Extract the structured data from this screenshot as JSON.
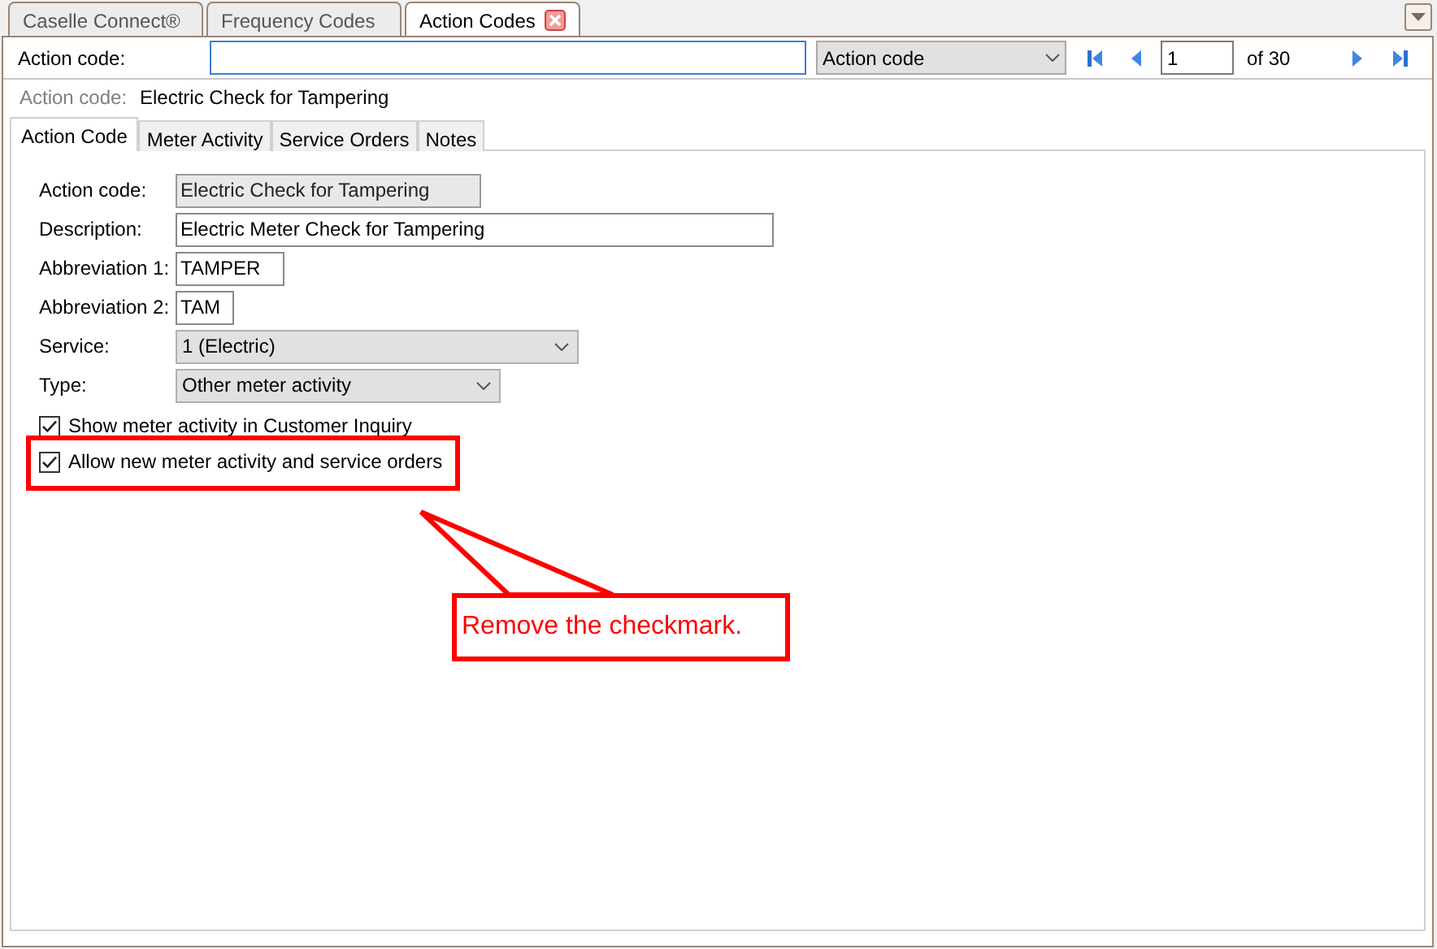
{
  "document_tabs": [
    {
      "label": "Caselle Connect®",
      "selected": false,
      "closable": false
    },
    {
      "label": "Frequency Codes",
      "selected": false,
      "closable": false
    },
    {
      "label": "Action Codes",
      "selected": true,
      "closable": true
    }
  ],
  "toolbar": {
    "label": "Action code:",
    "search_by": "Action code",
    "page": "1",
    "page_count": "of 30"
  },
  "record": {
    "label": "Action code:",
    "value": "Electric Check for Tampering"
  },
  "tabs": [
    {
      "label": "Action Code",
      "selected": true
    },
    {
      "label": "Meter Activity",
      "selected": false
    },
    {
      "label": "Service Orders",
      "selected": false
    },
    {
      "label": "Notes",
      "selected": false
    }
  ],
  "fields": [
    {
      "kind": "text",
      "label": "Action code:",
      "value": "Electric Check for Tampering",
      "readonly": true
    },
    {
      "kind": "text",
      "label": "Description:",
      "value": "Electric Meter Check for Tampering",
      "readonly": false
    },
    {
      "kind": "text",
      "label": "Abbreviation 1:",
      "value": "TAMPER",
      "readonly": false
    },
    {
      "kind": "text",
      "label": "Abbreviation 2:",
      "value": "TAM",
      "readonly": false
    },
    {
      "kind": "select",
      "label": "Service:",
      "value": "1 (Electric)"
    },
    {
      "kind": "select",
      "label": "Type:",
      "value": "Other meter activity"
    }
  ],
  "checkboxes": [
    {
      "label": "Show meter activity in Customer Inquiry",
      "checked": true
    },
    {
      "label": "Allow new meter activity and service orders",
      "checked": true
    }
  ],
  "annotation": {
    "text": "Remove the checkmark."
  }
}
